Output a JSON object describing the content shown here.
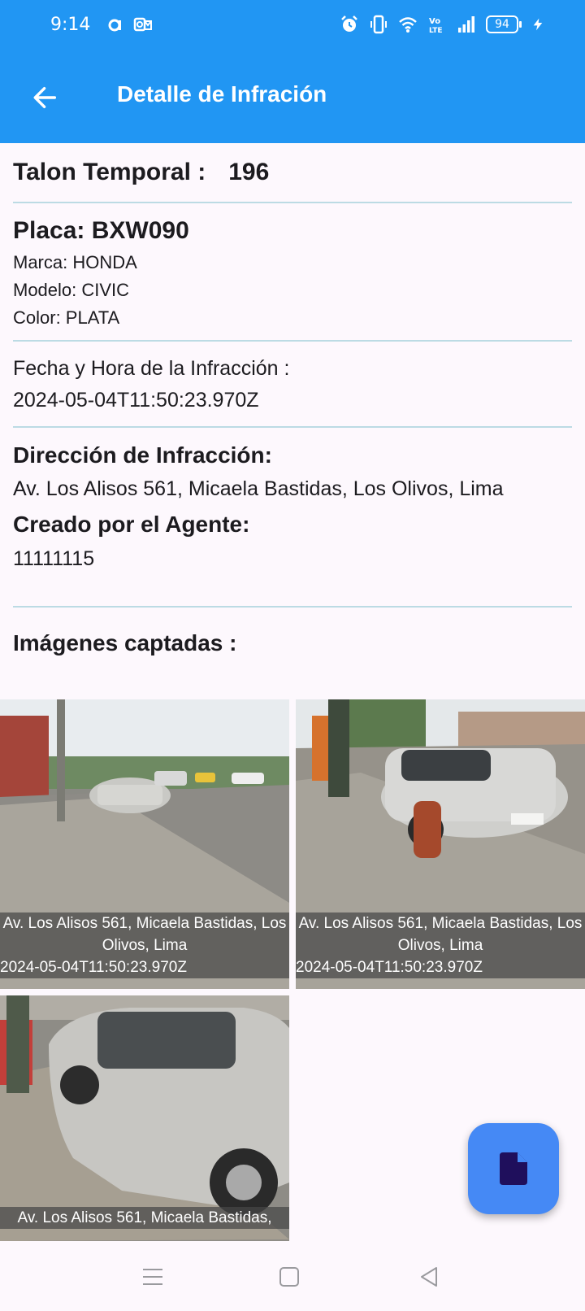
{
  "status_bar": {
    "time": "9:14",
    "battery": "94",
    "icons": [
      "notification-a-icon",
      "outlook-icon",
      "alarm-icon",
      "vibrate-icon",
      "wifi-icon",
      "volte-icon",
      "signal-icon",
      "battery-icon",
      "charging-icon"
    ]
  },
  "app_bar": {
    "title": "Detalle de Infración",
    "back_icon": "arrow-back-icon",
    "color": "#2196f3"
  },
  "detail": {
    "talon_label": "Talon Temporal :",
    "talon_number": "196",
    "placa": "Placa: BXW090",
    "marca": "Marca: HONDA",
    "modelo": "Modelo: CIVIC",
    "color": "Color: PLATA",
    "fecha_label": "Fecha y Hora de la Infracción :",
    "fecha_value": "2024-05-04T11:50:23.970Z",
    "direccion_label": "Dirección de Infracción:",
    "direccion_value": "Av. Los Alisos 561, Micaela Bastidas, Los Olivos, Lima",
    "agente_label": "Creado por el Agente:",
    "agente_value": "11111115",
    "images_title": "Imágenes captadas :"
  },
  "images": [
    {
      "address": "Av. Los Alisos 561, Micaela Bastidas, Los Olivos, Lima",
      "date": "2024-05-04T11:50:23.970Z"
    },
    {
      "address": "Av. Los Alisos 561, Micaela Bastidas, Los Olivos, Lima",
      "date": "2024-05-04T11:50:23.970Z"
    },
    {
      "address": "Av. Los Alisos 561, Micaela Bastidas,",
      "date": ""
    }
  ],
  "fab": {
    "icon": "document-icon",
    "color": "#4589f5"
  },
  "nav_bar": {
    "icons": [
      "menu-icon",
      "home-square-icon",
      "back-triangle-icon"
    ]
  }
}
